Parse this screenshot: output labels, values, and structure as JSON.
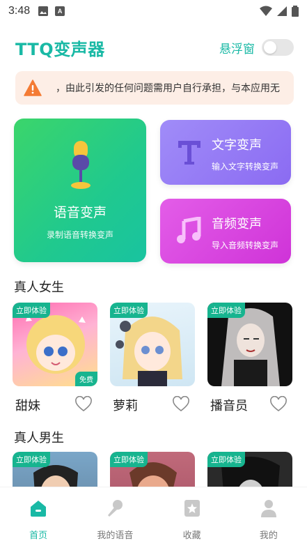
{
  "status": {
    "time": "3:48",
    "a_icon": "A"
  },
  "header": {
    "title": "TTQ变声器",
    "float_label": "悬浮窗",
    "float_on": false
  },
  "notice": {
    "text": "，由此引发的任何问题需用户自行承担，与本应用无"
  },
  "features": {
    "voice": {
      "title": "语音变声",
      "sub": "录制语音转换变声"
    },
    "text": {
      "title": "文字变声",
      "sub": "输入文字转换变声"
    },
    "audio": {
      "title": "音频变声",
      "sub": "导入音频转换变声"
    }
  },
  "female": {
    "title": "真人女生",
    "items": [
      {
        "name": "甜妹",
        "tag": "立即体验",
        "badge": "免费"
      },
      {
        "name": "萝莉",
        "tag": "立即体验"
      },
      {
        "name": "播音员",
        "tag": "立即体验"
      }
    ]
  },
  "male": {
    "title": "真人男生",
    "items": [
      {
        "tag": "立即体验"
      },
      {
        "tag": "立即体验"
      },
      {
        "tag": "立即体验"
      }
    ]
  },
  "nav": [
    {
      "label": "首页",
      "icon": "home-icon"
    },
    {
      "label": "我的语音",
      "icon": "microphone-icon"
    },
    {
      "label": "收藏",
      "icon": "star-icon"
    },
    {
      "label": "我的",
      "icon": "user-icon"
    }
  ],
  "colors": {
    "accent": "#19b9a5",
    "tag": "#17b48f"
  }
}
